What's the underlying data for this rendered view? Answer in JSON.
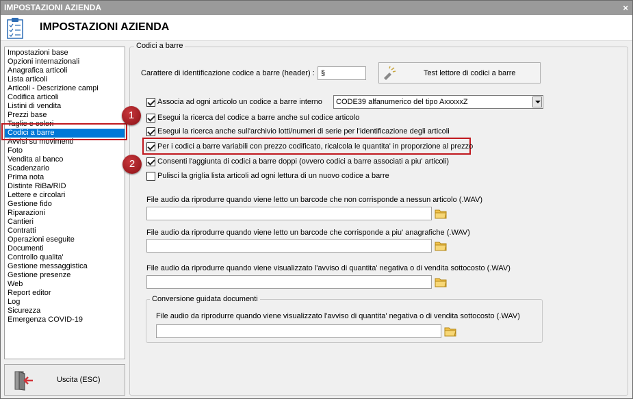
{
  "window": {
    "title": "IMPOSTAZIONI AZIENDA",
    "close_glyph": "×"
  },
  "header": {
    "title": "IMPOSTAZIONI AZIENDA",
    "icon": "clipboard-checklist-icon"
  },
  "nav": {
    "items": [
      "Impostazioni base",
      "Opzioni internazionali",
      "Anagrafica articoli",
      "Lista articoli",
      "Articoli - Descrizione campi",
      "Codifica articoli",
      "Listini di vendita",
      "Prezzi base",
      "Taglie e colori",
      "Codici a barre",
      "Avvisi su movimenti",
      "Foto",
      "Vendita al banco",
      "Scadenzario",
      "Prima nota",
      "Distinte RiBa/RID",
      "Lettere e circolari",
      "Gestione fido",
      "Riparazioni",
      "Cantieri",
      "Contratti",
      "Operazioni eseguite",
      "Documenti",
      "Controllo qualita'",
      "Gestione messaggistica",
      "Gestione presenze",
      "Web",
      "Report editor",
      "Log",
      "Sicurezza",
      "Emergenza COVID-19"
    ],
    "selected_index": 9,
    "exit_label": "Uscita (ESC)"
  },
  "barcode": {
    "group_label": "Codici a barre",
    "header_char_label": "Carattere di identificazione codice a barre (header) :",
    "header_char_value": "§",
    "test_button_label": "Test lettore di codici a barre",
    "options": [
      {
        "label": "Associa ad ogni articolo un codice a barre interno",
        "checked": true
      },
      {
        "label": "Esegui la ricerca del codice a barre anche sul codice articolo",
        "checked": true
      },
      {
        "label": "Esegui la ricerca anche sull'archivio lotti/numeri di serie per l'identificazione degli articoli",
        "checked": true
      },
      {
        "label": "Per i codici a barre variabili con prezzo codificato, ricalcola le quantita' in proporzione al prezzo",
        "checked": true
      },
      {
        "label": "Consenti l'aggiunta di codici a barre doppi (ovvero codici a barre associati a piu' articoli)",
        "checked": true
      },
      {
        "label": "Pulisci la griglia lista articoli ad ogni lettura di un nuovo codice a barre",
        "checked": false
      }
    ],
    "barcode_type_value": "CODE39 alfanumerico del tipo AxxxxxZ",
    "audio_fields": [
      {
        "label": "File audio da riprodurre quando viene letto un barcode che non corrisponde a nessun articolo (.WAV)",
        "value": ""
      },
      {
        "label": "File audio da riprodurre quando viene letto un barcode che corrisponde a piu' anagrafiche (.WAV)",
        "value": ""
      },
      {
        "label": "File audio da riprodurre quando viene visualizzato l'avviso di quantita' negativa o di vendita sottocosto (.WAV)",
        "value": ""
      }
    ],
    "conversion": {
      "group_label": "Conversione guidata documenti",
      "audio_label": "File audio da riprodurre quando viene visualizzato l'avviso di quantita' negativa o di vendita sottocosto (.WAV)",
      "audio_value": ""
    }
  },
  "annotations": {
    "badge1": "1",
    "badge2": "2",
    "accent_color": "#c0181e"
  }
}
